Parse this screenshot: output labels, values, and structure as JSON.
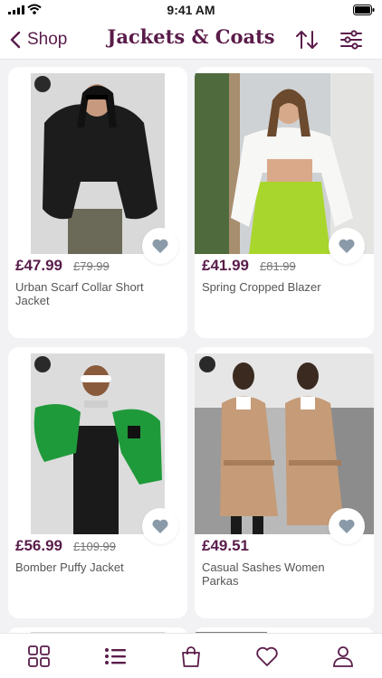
{
  "status_bar": {
    "time": "9:41 AM"
  },
  "nav": {
    "back_label": "Shop",
    "title": "Jackets & Coats"
  },
  "products": [
    {
      "price": "£47.99",
      "old_price": "£79.99",
      "name": "Urban Scarf Collar Short Jacket"
    },
    {
      "price": "£41.99",
      "old_price": "£81.99",
      "name": "Spring Cropped Blazer"
    },
    {
      "price": "£56.99",
      "old_price": "£109.99",
      "name": "Bomber Puffy Jacket"
    },
    {
      "price": "£49.51",
      "old_price": "",
      "name": "Casual Sashes Women Parkas"
    }
  ],
  "colors": {
    "accent": "#5a1c4a",
    "icon_gray": "#8a9aa8",
    "background": "#f2f2f4"
  },
  "tab_bar": {
    "icons": [
      "grid-icon",
      "list-icon",
      "bag-icon",
      "heart-icon",
      "profile-icon"
    ],
    "active": "list-icon"
  }
}
